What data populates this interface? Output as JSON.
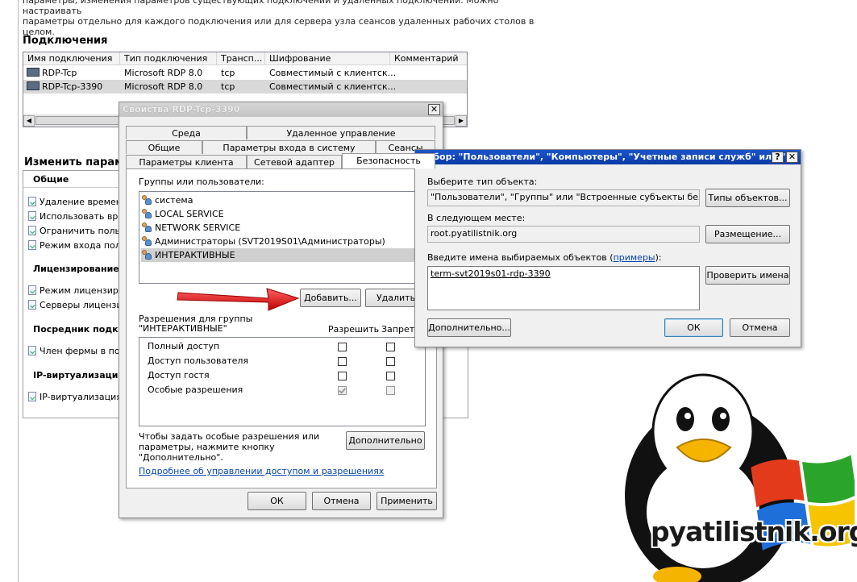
{
  "background": {
    "description_line1": "параметры, изменения параметров существующих подключений и удаленных подключений. Можно настраивать",
    "description_line2": "параметры отдельно для каждого подключения или для сервера узла сеансов удаленных рабочих столов в целом.",
    "connections_title": "Подключения",
    "columns": [
      "Имя подключения",
      "Тип подключения",
      "Трансп...",
      "Шифрование",
      "Комментарий"
    ],
    "rows": [
      {
        "name": "RDP-Tcp",
        "type": "Microsoft RDP 8.0",
        "transport": "tcp",
        "encryption": "Совместимый с клиентск..."
      },
      {
        "name": "RDP-Tcp-3390",
        "type": "Microsoft RDP 8.0",
        "transport": "tcp",
        "encryption": "Совместимый с клиентск..."
      }
    ],
    "edit_title": "Изменить параметры",
    "groups": [
      {
        "title": "Общие",
        "items": [
          "Удаление временных",
          "Использовать врем",
          "Ограничить польз",
          "Режим входа поль"
        ]
      },
      {
        "title": "Лицензирование",
        "items": [
          "Режим лицензиров",
          "Серверы лицензир"
        ]
      },
      {
        "title": "Посредник подкл",
        "items": [
          "Член фермы в пос"
        ]
      },
      {
        "title": "IP-виртуализация",
        "items": [
          "IP-виртуализация"
        ]
      }
    ]
  },
  "props_dialog": {
    "title": "Свойства RDP-Tcp-3390",
    "close_label": "✕",
    "tabs_row1": [
      "Среда",
      "Удаленное управление"
    ],
    "tabs_row2": [
      "Общие",
      "Параметры входа в систему",
      "Сеансы"
    ],
    "tabs_row3": [
      "Параметры клиента",
      "Сетевой адаптер",
      "Безопасность"
    ],
    "groups_label": "Группы или пользователи:",
    "users": [
      "система",
      "LOCAL SERVICE",
      "NETWORK SERVICE",
      "Администраторы (SVT2019S01\\Администраторы)",
      "ИНТЕРАКТИВНЫЕ"
    ],
    "selected_user_index": 4,
    "add_button": "Добавить...",
    "remove_button": "Удалить",
    "perm_label_line1": "Разрешения для группы",
    "perm_label_line2": "\"ИНТЕРАКТИВНЫЕ\"",
    "allow_header": "Разрешить",
    "deny_header": "Запретить",
    "permissions": [
      {
        "name": "Полный доступ",
        "allow": false,
        "deny": false
      },
      {
        "name": "Доступ пользователя",
        "allow": false,
        "deny": false
      },
      {
        "name": "Доступ гостя",
        "allow": false,
        "deny": false
      },
      {
        "name": "Особые разрешения",
        "allow": true,
        "deny": false
      }
    ],
    "special_hint_line1": "Чтобы задать особые разрешения или",
    "special_hint_line2": "параметры, нажмите кнопку \"Дополнительно\".",
    "advanced_button": "Дополнительно",
    "help_link": "Подробнее об управлении доступом и разрешениях",
    "ok_button": "ОК",
    "cancel_button": "Отмена",
    "apply_button": "Применить"
  },
  "select_dialog": {
    "title": "Выбор: \"Пользователи\", \"Компьютеры\", \"Учетные записи служб\" или \"...",
    "help_label": "?",
    "close_label": "✕",
    "object_type_label": "Выберите тип объекта:",
    "object_type_value": "\"Пользователи\", \"Группы\" или \"Встроенные субъекты безопасн",
    "object_types_button": "Типы объектов...",
    "location_label": "В следующем месте:",
    "location_value": "root.pyatilistnik.org",
    "location_button": "Размещение...",
    "names_label": "Введите имена выбираемых объектов (",
    "names_label_link": "примеры",
    "names_label_end": "):",
    "names_value": "term-svt2019s01-rdp-3390",
    "check_names_button": "Проверить имена",
    "advanced_button": "Дополнительно...",
    "ok_button": "ОК",
    "cancel_button": "Отмена"
  },
  "watermark": {
    "text": "pyatilistnik.org"
  },
  "colors": {
    "arrow": "#e01010",
    "active_title": "#0a3aa6",
    "window_yellow": "#f6c400",
    "window_green": "#2aa52a",
    "window_red": "#e43a1c",
    "window_blue": "#1e6fd9"
  }
}
